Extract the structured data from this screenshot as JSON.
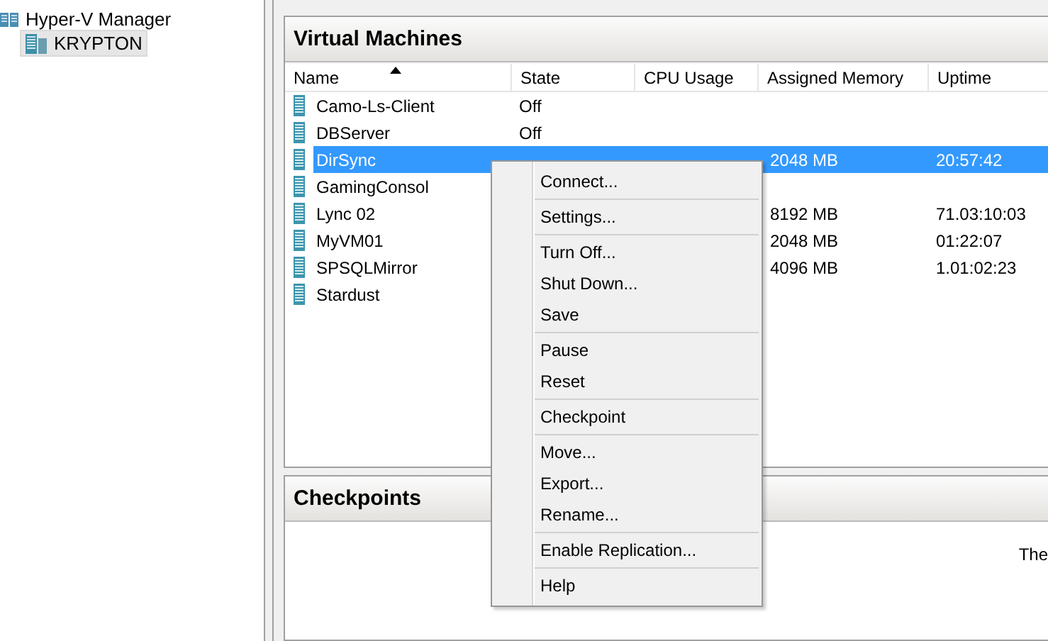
{
  "tree": {
    "label": "Hyper-V Manager",
    "children": [
      {
        "label": "KRYPTON",
        "selected": true
      }
    ]
  },
  "virtual_machines": {
    "title": "Virtual Machines",
    "columns": [
      {
        "label": "Name",
        "sorted": true
      },
      {
        "label": "State",
        "sorted": false
      },
      {
        "label": "CPU Usage",
        "sorted": false
      },
      {
        "label": "Assigned Memory",
        "sorted": false
      },
      {
        "label": "Uptime",
        "sorted": false
      }
    ],
    "rows": [
      {
        "name": "Camo-Ls-Client",
        "state": "Off",
        "selected": false
      },
      {
        "name": "DBServer",
        "state": "Off",
        "selected": false
      },
      {
        "name": "DirSync",
        "memory": "2048 MB",
        "uptime": "20:57:42",
        "selected": true
      },
      {
        "name": "GamingConsol",
        "selected": false
      },
      {
        "name": "Lync 02",
        "memory": "8192 MB",
        "uptime": "71.03:10:03",
        "selected": false
      },
      {
        "name": "MyVM01",
        "memory": "2048 MB",
        "uptime": "01:22:07",
        "selected": false
      },
      {
        "name": "SPSQLMirror",
        "memory": "4096 MB",
        "uptime": "1.01:02:23",
        "selected": false
      },
      {
        "name": "Stardust",
        "selected": false
      }
    ]
  },
  "checkpoints": {
    "title": "Checkpoints",
    "text": "The"
  },
  "context_menu": {
    "groups": [
      [
        "Connect..."
      ],
      [
        "Settings..."
      ],
      [
        "Turn Off...",
        "Shut Down...",
        "Save"
      ],
      [
        "Pause",
        "Reset"
      ],
      [
        "Checkpoint"
      ],
      [
        "Move...",
        "Export...",
        "Rename..."
      ],
      [
        "Enable Replication..."
      ],
      [
        "Help"
      ]
    ]
  }
}
